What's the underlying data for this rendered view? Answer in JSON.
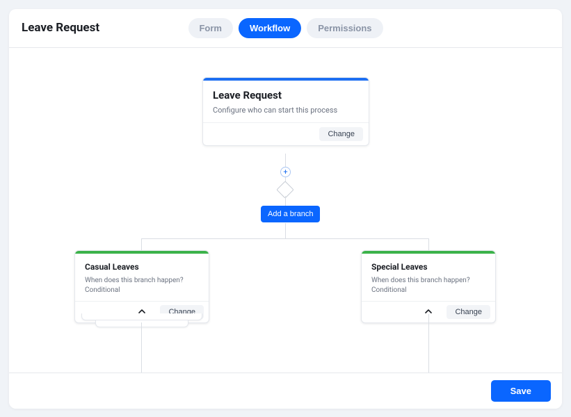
{
  "header": {
    "title": "Leave Request",
    "tabs": {
      "form": "Form",
      "workflow": "Workflow",
      "permissions": "Permissions"
    }
  },
  "workflow": {
    "start": {
      "title": "Leave Request",
      "description": "Configure who can start this process",
      "change_label": "Change"
    },
    "add_branch_label": "Add a branch",
    "branches": {
      "left": {
        "title": "Casual Leaves",
        "question": "When does this branch happen?",
        "condition": "Conditional",
        "change_label": "Change"
      },
      "right": {
        "title": "Special Leaves",
        "question": "When does this branch happen?",
        "condition": "Conditional",
        "change_label": "Change"
      }
    }
  },
  "footer": {
    "save_label": "Save"
  }
}
